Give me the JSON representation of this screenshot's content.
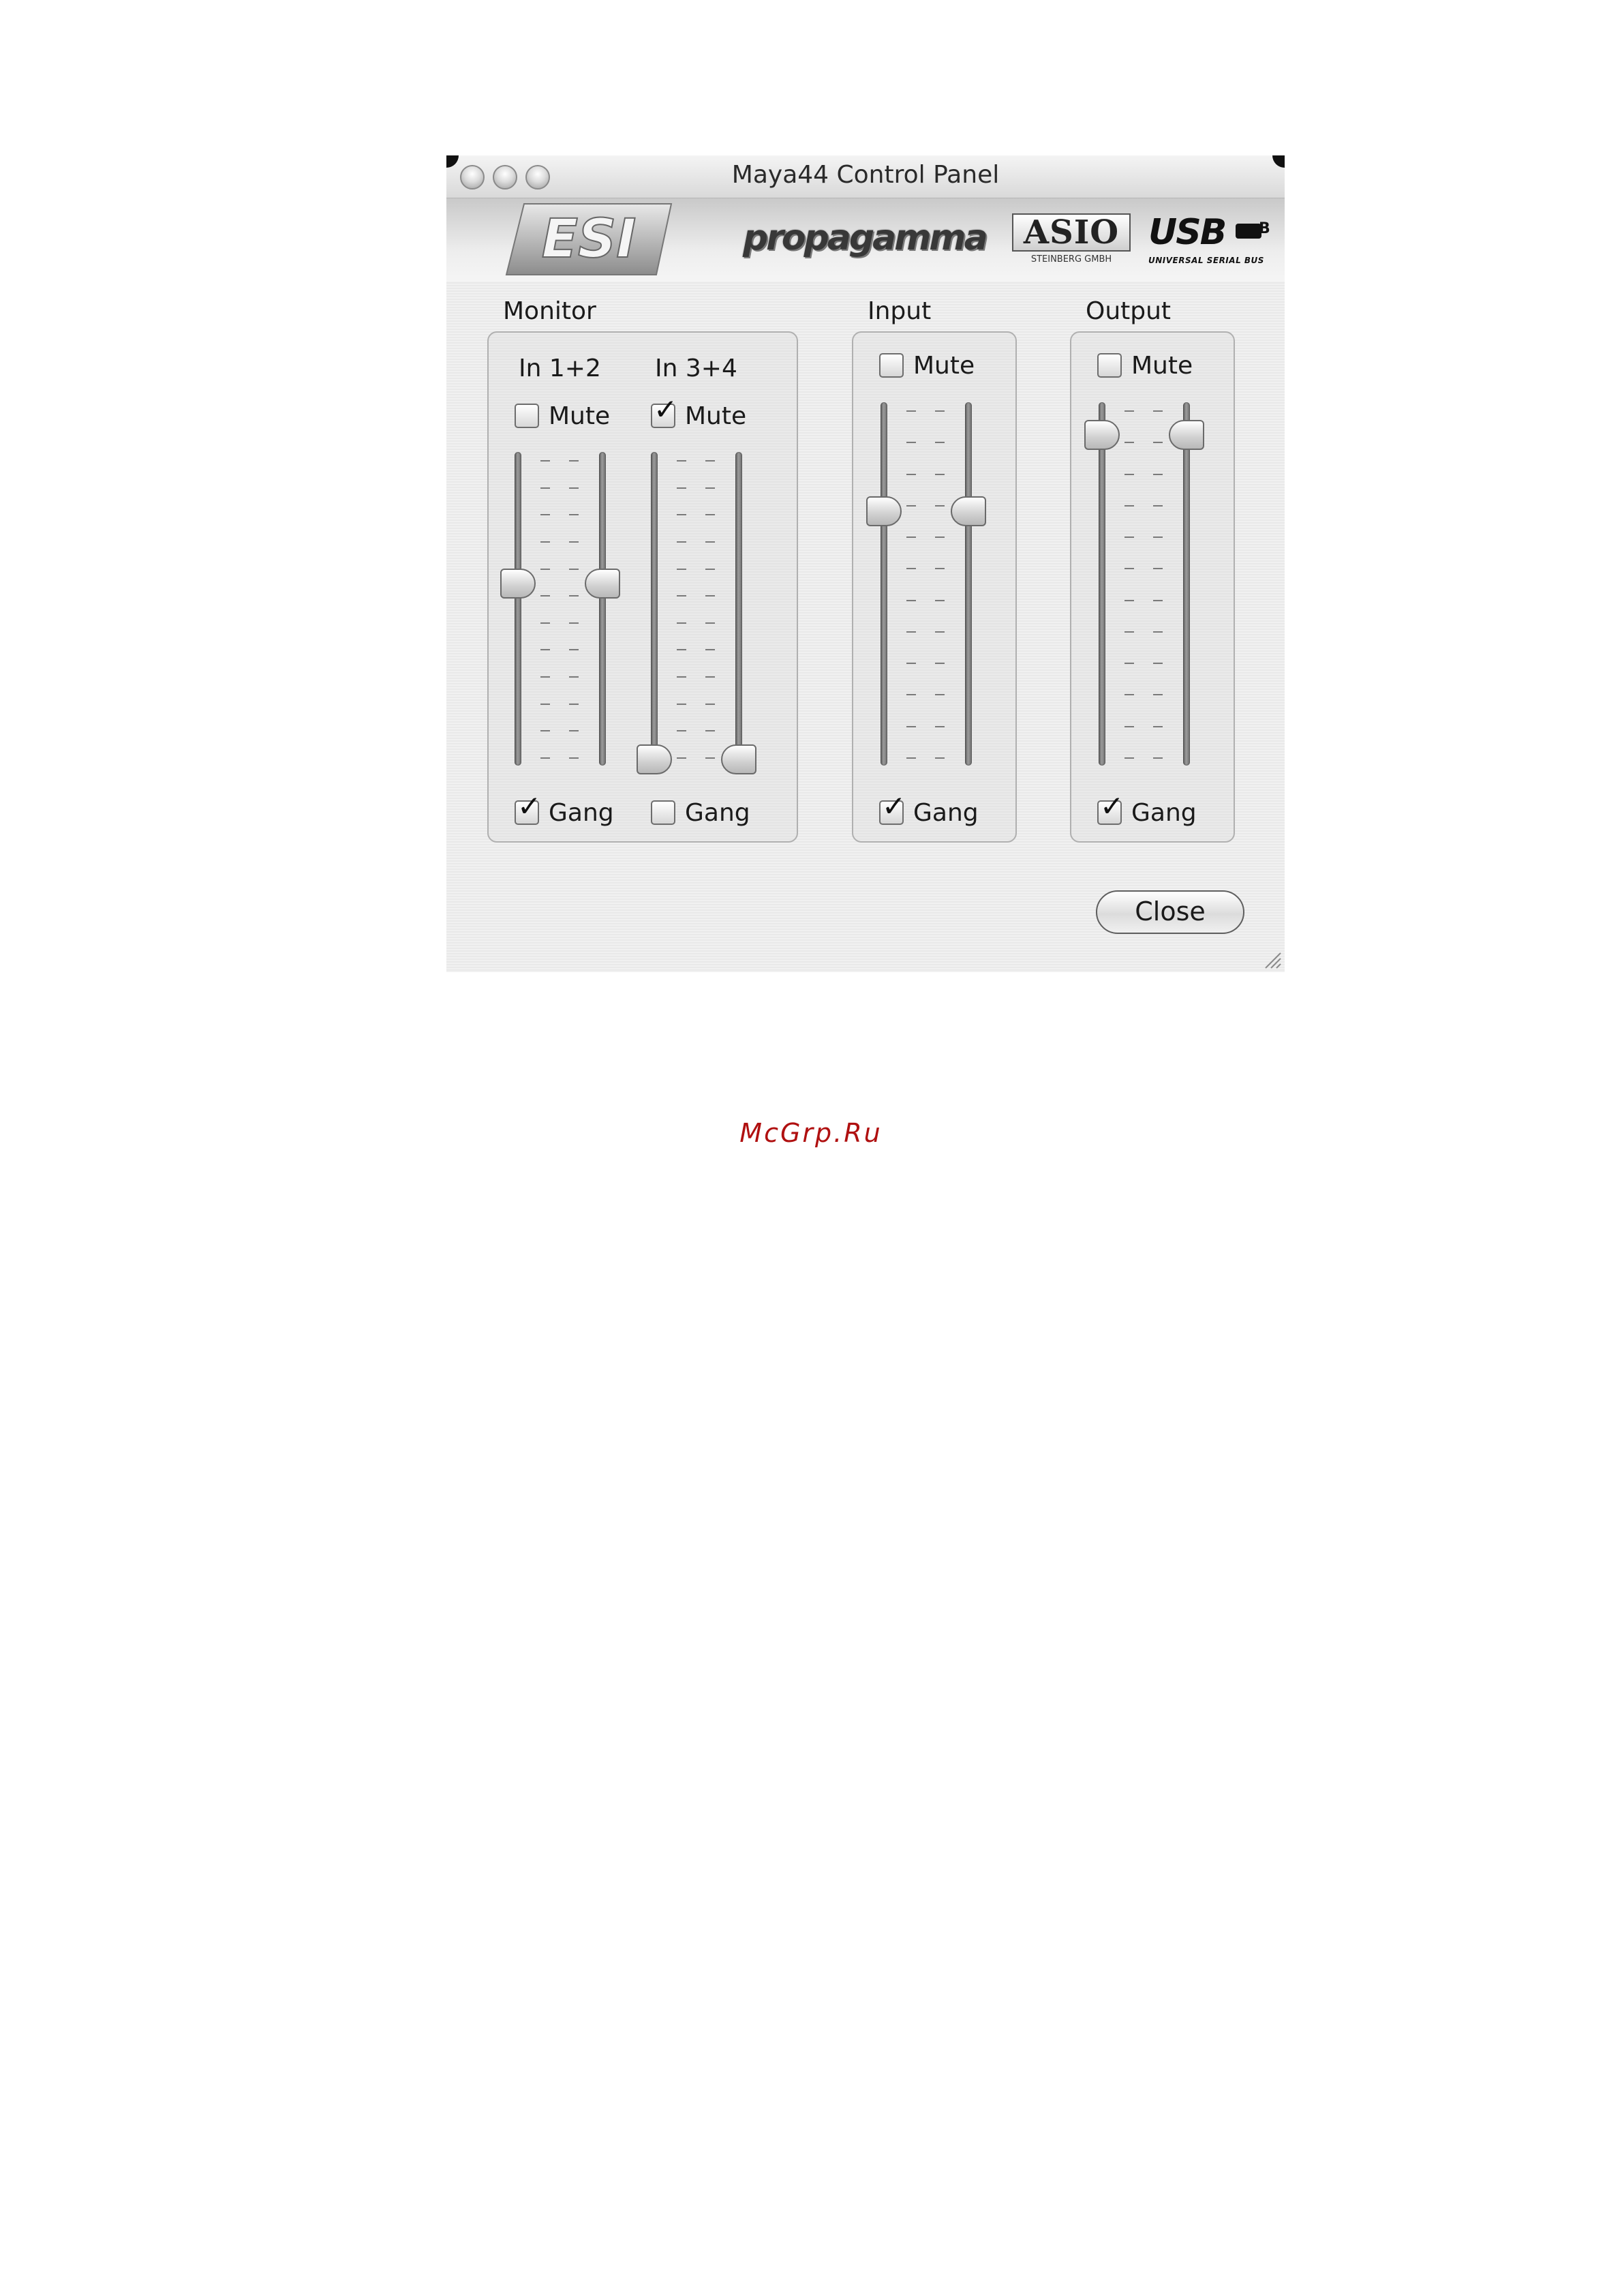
{
  "window": {
    "title": "Maya44 Control Panel"
  },
  "banner": {
    "logos": [
      "ESI",
      "propagamma",
      "ASIO",
      "USB"
    ],
    "esi_text": "ESI",
    "propagamma_text": "propagamma",
    "asio_text": "ASIO",
    "asio_subtext": "STEINBERG GMBH",
    "usb_text": "USB",
    "usb_b": "B",
    "usb_subtext": "UNIVERSAL SERIAL BUS"
  },
  "monitor": {
    "label": "Monitor",
    "channels": [
      {
        "label": "In 1+2",
        "mute_label": "Mute",
        "mute": false,
        "gang_label": "Gang",
        "gang": true,
        "left_level": 0.58,
        "right_level": 0.58
      },
      {
        "label": "In 3+4",
        "mute_label": "Mute",
        "mute": true,
        "gang_label": "Gang",
        "gang": false,
        "left_level": 0.02,
        "right_level": 0.02
      }
    ]
  },
  "input": {
    "label": "Input",
    "mute_label": "Mute",
    "mute": false,
    "gang_label": "Gang",
    "gang": true,
    "left_level": 0.7,
    "right_level": 0.7
  },
  "output": {
    "label": "Output",
    "mute_label": "Mute",
    "mute": false,
    "gang_label": "Gang",
    "gang": true,
    "left_level": 0.91,
    "right_level": 0.91
  },
  "buttons": {
    "close_label": "Close"
  },
  "watermark": "McGrp.Ru",
  "colors": {
    "window_bg": "#eeeeee",
    "watermark": "#b01010"
  },
  "icons": [
    "close-circle-icon",
    "minimize-circle-icon",
    "zoom-circle-icon",
    "resize-grip-icon"
  ]
}
